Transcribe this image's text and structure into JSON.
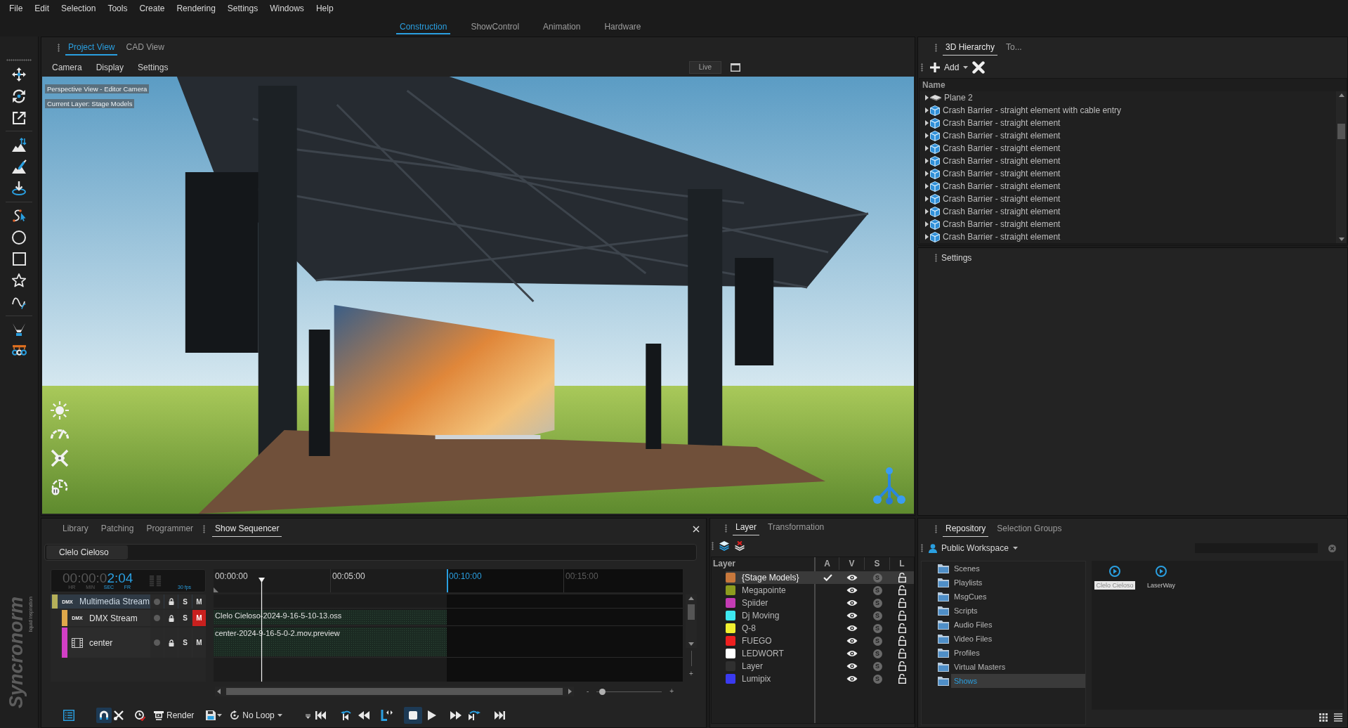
{
  "menu": [
    "File",
    "Edit",
    "Selection",
    "Tools",
    "Create",
    "Rendering",
    "Settings",
    "Windows",
    "Help"
  ],
  "mode_tabs": [
    {
      "label": "Construction",
      "selected": true
    },
    {
      "label": "ShowControl",
      "selected": false
    },
    {
      "label": "Animation",
      "selected": false
    },
    {
      "label": "Hardware",
      "selected": false
    }
  ],
  "brand": {
    "logo": "Syncronorm",
    "tagline": "liquid inspiration"
  },
  "viewport": {
    "tabs": [
      {
        "label": "Project View",
        "selected": true
      },
      {
        "label": "CAD View",
        "selected": false
      }
    ],
    "menu": [
      "Camera",
      "Display",
      "Settings"
    ],
    "live_button": "Live",
    "overlay_labels": [
      "Perspective View - Editor Camera",
      "Current Layer: Stage Models"
    ]
  },
  "hierarchy": {
    "tabs": [
      {
        "label": "3D Hierarchy",
        "selected": true
      },
      {
        "label": "To...",
        "selected": false
      }
    ],
    "add_button": "Add",
    "column": "Name",
    "items": [
      {
        "label": "Plane 2",
        "kind": "plane",
        "expanded": false
      },
      {
        "label": "Crash Barrier - straight element with cable entry",
        "kind": "model",
        "expanded": false
      },
      {
        "label": "Crash Barrier - straight element",
        "kind": "model",
        "expanded": false
      },
      {
        "label": "Crash Barrier - straight element",
        "kind": "model",
        "expanded": false
      },
      {
        "label": "Crash Barrier - straight element",
        "kind": "model",
        "expanded": false
      },
      {
        "label": "Crash Barrier - straight element",
        "kind": "model",
        "expanded": false
      },
      {
        "label": "Crash Barrier - straight element",
        "kind": "model",
        "expanded": false
      },
      {
        "label": "Crash Barrier - straight element",
        "kind": "model",
        "expanded": false
      },
      {
        "label": "Crash Barrier - straight element",
        "kind": "model",
        "expanded": false
      },
      {
        "label": "Crash Barrier - straight element",
        "kind": "model",
        "expanded": false
      },
      {
        "label": "Crash Barrier - straight element",
        "kind": "model",
        "expanded": false
      },
      {
        "label": "Crash Barrier - straight element",
        "kind": "model",
        "expanded": false
      }
    ]
  },
  "settings_panel": {
    "title": "Settings"
  },
  "sequencer": {
    "tabs": [
      {
        "label": "Library",
        "selected": false
      },
      {
        "label": "Patching",
        "selected": false
      },
      {
        "label": "Programmer",
        "selected": false
      },
      {
        "label": "Show Sequencer",
        "selected": true
      }
    ],
    "shows": [
      {
        "label": "Clelo Cieloso",
        "selected": true
      }
    ],
    "timecode": {
      "dim": "00:00:0",
      "lit": "2:04",
      "units": [
        {
          "label": "HR",
          "lit": false
        },
        {
          "label": "MIN",
          "lit": false
        },
        {
          "label": "SEC",
          "lit": true
        },
        {
          "label": "FR",
          "lit": true
        }
      ],
      "fps": "30 fps"
    },
    "ruler": [
      {
        "label": "00:00:00",
        "kind": "tick"
      },
      {
        "label": "00:05:00",
        "kind": "tick"
      },
      {
        "label": "00:10:00",
        "kind": "end"
      },
      {
        "label": "00:15:00",
        "kind": "past"
      }
    ],
    "playhead": {
      "level": 0.103
    },
    "tracks": [
      {
        "name": "Multimedia Stream",
        "badge": "DMX",
        "kind": "stream",
        "color": "#b5b05a",
        "selected": true,
        "solo": "S",
        "mute": "M",
        "muted": false,
        "children": [
          {
            "name": "DMX Stream",
            "badge": "DMX",
            "kind": "dmx",
            "color": "#e0a84a",
            "selected": false,
            "solo": "S",
            "mute": "M",
            "muted": true,
            "clip": "Clelo Cieloso-2024-9-16-5-10-13.oss"
          },
          {
            "name": "center",
            "kind": "video",
            "color": "#d23fc6",
            "selected": false,
            "solo": "S",
            "mute": "M",
            "muted": false,
            "clip": "center-2024-9-16-5-0-2.mov.preview"
          }
        ]
      }
    ],
    "track_zoom": {
      "plus": "+"
    },
    "zoom": {
      "minus": "-",
      "plus": "+",
      "level": 0.09
    },
    "snap": true,
    "render_button": "Render",
    "loop_dropdown": "No Loop",
    "playing": false
  },
  "layers": {
    "tabs": [
      {
        "label": "Layer",
        "selected": true
      },
      {
        "label": "Transformation",
        "selected": false
      }
    ],
    "columns": [
      "Layer",
      "A",
      "V",
      "S",
      "L"
    ],
    "rows": [
      {
        "name": "{Stage Models}",
        "color": "#c8783c",
        "selected": true,
        "active": true,
        "visible": true,
        "solo": {
          "label": "S",
          "on": false
        },
        "locked": false
      },
      {
        "name": "Megapointe",
        "color": "#8c9c1e",
        "selected": false,
        "active": false,
        "visible": true,
        "solo": {
          "label": "S",
          "on": false
        },
        "locked": false
      },
      {
        "name": "Spiider",
        "color": "#c43cb4",
        "selected": false,
        "active": false,
        "visible": true,
        "solo": {
          "label": "S",
          "on": false
        },
        "locked": false
      },
      {
        "name": "Dj Moving",
        "color": "#3ee8f0",
        "selected": false,
        "active": false,
        "visible": true,
        "solo": {
          "label": "S",
          "on": false
        },
        "locked": false
      },
      {
        "name": "Q-8",
        "color": "#f0f030",
        "selected": false,
        "active": false,
        "visible": true,
        "solo": {
          "label": "S",
          "on": false
        },
        "locked": false
      },
      {
        "name": "FUEGO",
        "color": "#ee2020",
        "selected": false,
        "active": false,
        "visible": true,
        "solo": {
          "label": "S",
          "on": false
        },
        "locked": false
      },
      {
        "name": "LEDWORT",
        "color": "#ffffff",
        "selected": false,
        "active": false,
        "visible": true,
        "solo": {
          "label": "S",
          "on": false
        },
        "locked": false
      },
      {
        "name": "Layer",
        "color": "#303030",
        "selected": false,
        "active": false,
        "visible": true,
        "solo": {
          "label": "S",
          "on": false
        },
        "locked": false
      },
      {
        "name": "Lumipix",
        "color": "#3a3af0",
        "selected": false,
        "active": false,
        "visible": true,
        "solo": {
          "label": "S",
          "on": false
        },
        "locked": false
      }
    ]
  },
  "repository": {
    "tabs": [
      {
        "label": "Repository",
        "selected": true
      },
      {
        "label": "Selection Groups",
        "selected": false
      }
    ],
    "workspace": "Public Workspace",
    "folders": [
      {
        "label": "Scenes",
        "selected": false
      },
      {
        "label": "Playlists",
        "selected": false
      },
      {
        "label": "MsgCues",
        "selected": false
      },
      {
        "label": "Scripts",
        "selected": false
      },
      {
        "label": "Audio Files",
        "selected": false
      },
      {
        "label": "Video Files",
        "selected": false
      },
      {
        "label": "Profiles",
        "selected": false
      },
      {
        "label": "Virtual Masters",
        "selected": false
      },
      {
        "label": "Shows",
        "selected": true
      }
    ],
    "items": [
      {
        "label": "Clelo Cieloso",
        "selected": true
      },
      {
        "label": "LaserWay",
        "selected": false
      }
    ]
  }
}
